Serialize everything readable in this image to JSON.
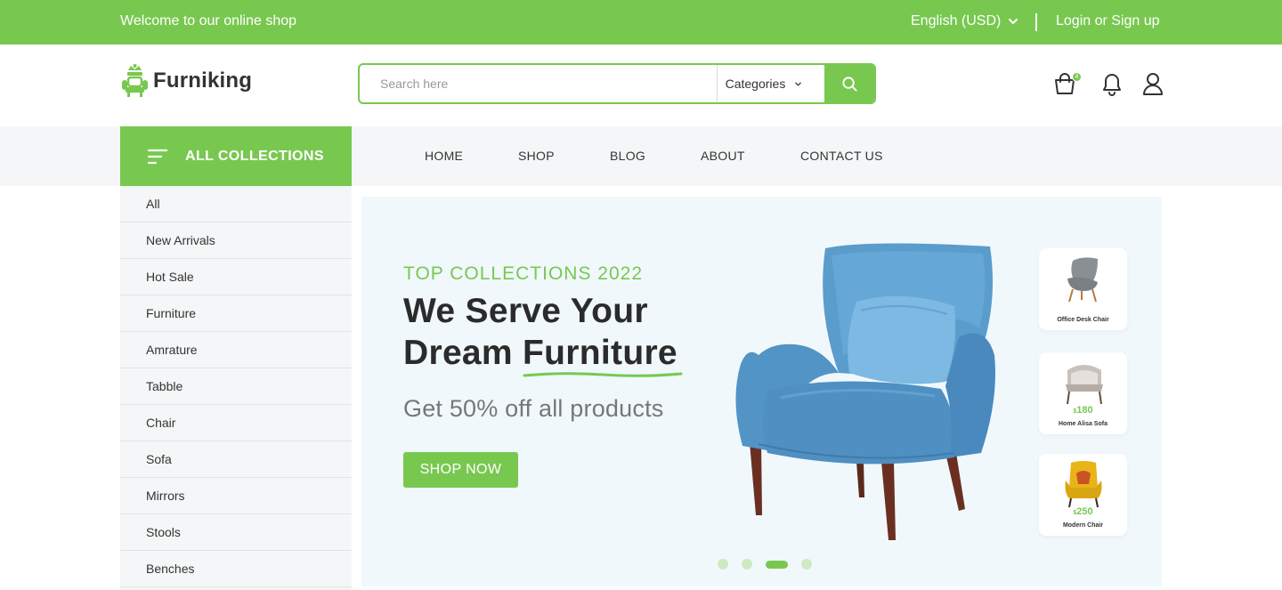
{
  "topbar": {
    "welcome": "Welcome to our online shop",
    "language": "English (USD)",
    "login": "Login or Sign up"
  },
  "header": {
    "brand": "Furniking",
    "search_placeholder": "Search here",
    "category_select": "Categories",
    "cart_count": "4"
  },
  "nav": {
    "all_collections": "ALL COLLECTIONS",
    "menu": [
      "HOME",
      "SHOP",
      "BLOG",
      "ABOUT",
      "CONTACT US"
    ]
  },
  "sidebar": {
    "items": [
      "All",
      "New Arrivals",
      "Hot Sale",
      "Furniture",
      "Amrature",
      "Tabble",
      "Chair",
      "Sofa",
      "Mirrors",
      "Stools",
      "Benches"
    ]
  },
  "hero": {
    "eyebrow": "TOP COLLECTIONS 2022",
    "headline_line1": "We Serve Your",
    "headline_line2_prefix": "Dream ",
    "headline_highlight": "Furniture",
    "offer": "Get 50% off all products",
    "cta": "SHOP NOW",
    "products": [
      {
        "name": "Office Desk Chair",
        "currency": "",
        "price": ""
      },
      {
        "name": "Home Alisa Sofa",
        "currency": "$",
        "price": "180"
      },
      {
        "name": "Modern Chair",
        "currency": "$",
        "price": "250"
      }
    ],
    "slider": {
      "slides": 4,
      "active_index": 2
    }
  },
  "colors": {
    "brand_green": "#78c850",
    "hero_bg": "#f0f8fc",
    "panel_gray": "#f5f6f7",
    "armchair_blue": "#5a9ccc"
  },
  "icons": {
    "cart": "shopping-bag-icon",
    "notifications": "bell-icon",
    "account": "user-icon",
    "search": "search-icon",
    "menu": "hamburger-icon",
    "dropdown": "chevron-down-icon"
  }
}
